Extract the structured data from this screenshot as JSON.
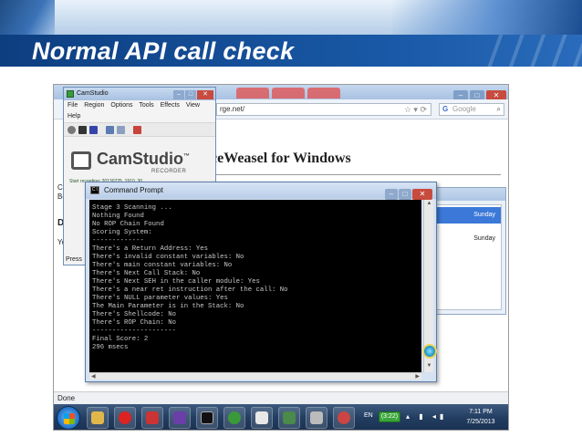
{
  "slide": {
    "title": "Normal API call check"
  },
  "browser": {
    "url_text": "rge.net/",
    "search_placeholder": "Google",
    "search_engine_letter": "G",
    "page_heading": "ceWeasel for Windows",
    "side_text": [
      "Cu",
      "Be",
      "De",
      "Yo"
    ],
    "status_text": "Done"
  },
  "dialog": {
    "rows": [
      {
        "day": "Sunday",
        "selected": true
      },
      {
        "day": "Sunday",
        "selected": false
      }
    ]
  },
  "camstudio": {
    "window_title": "CamStudio",
    "menu": [
      "File",
      "Region",
      "Options",
      "Tools",
      "Effects",
      "View",
      "Help"
    ],
    "logo_name": "CamStudio",
    "logo_tm": "™",
    "logo_sub": "RECORDER",
    "status_line": "Start recording: 20130725_1910_30",
    "footer_text": "Press"
  },
  "cmd": {
    "window_title": "Command Prompt",
    "icon_text": "C:\\",
    "lines": [
      "Stage 3 Scanning ...",
      "Nothing Found",
      "No ROP Chain Found",
      "Scoring System:",
      "-------------",
      "There's a Return Address: Yes",
      "There's invalid constant variables: No",
      "There's main constant variables: No",
      "There's Next Call Stack: No",
      "There's Next SEH in the caller module: Yes",
      "There's a near ret instruction after the call: No",
      "There's NULL parameter values: Yes",
      "The Main Parameter is in the Stack: No",
      "There's Shellcode: No",
      "There's ROP Chain: No",
      "---------------------",
      "Final Score: 2",
      "296 msecs"
    ]
  },
  "taskbar": {
    "language": "EN",
    "battery": "(3:22)",
    "time": "7:11 PM",
    "date": "7/25/2013"
  },
  "colors": {
    "title_band": "#1a5aa8",
    "console_bg": "#000000",
    "console_fg": "#c8c8c8"
  }
}
